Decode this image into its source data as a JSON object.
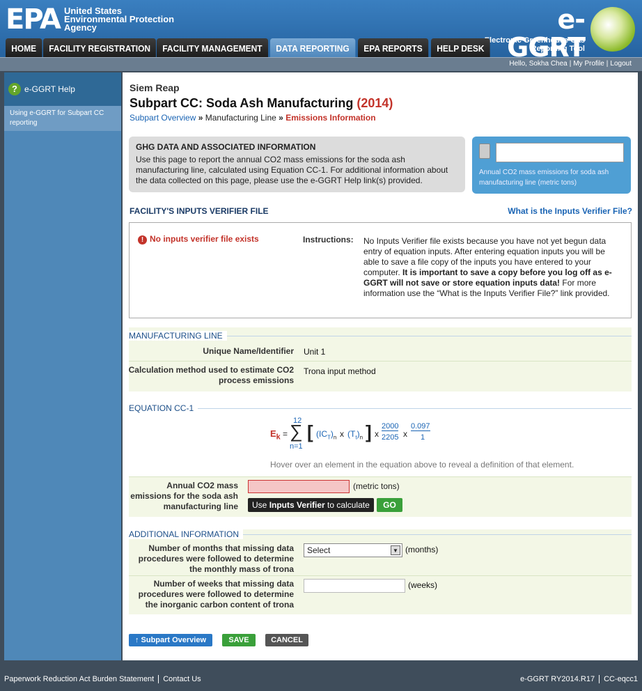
{
  "header": {
    "epa_mark": "EPA",
    "agency_line1": "United States",
    "agency_line2": "Environmental Protection",
    "agency_line3": "Agency",
    "app_name": "e-GGRT",
    "tagline1": "Electronic Greenhouse Gas",
    "tagline2": "Reporting Tool"
  },
  "nav": {
    "tabs": [
      "HOME",
      "FACILITY REGISTRATION",
      "FACILITY MANAGEMENT",
      "DATA REPORTING",
      "EPA REPORTS",
      "HELP DESK"
    ],
    "active_tab": "DATA REPORTING"
  },
  "user": {
    "greeting": "Hello, Sokha Chea",
    "profile": "My Profile",
    "logout": "Logout"
  },
  "sidebar": {
    "help_title": "e-GGRT Help",
    "help_link": "Using e-GGRT for Subpart CC reporting"
  },
  "page": {
    "facility": "Siem Reap",
    "title": "Subpart CC: Soda Ash Manufacturing",
    "year": "(2014)",
    "breadcrumb": [
      "Subpart Overview",
      "Manufacturing Line",
      "Emissions Information"
    ],
    "crumb_sep": "»"
  },
  "ghg": {
    "title": "GHG DATA AND ASSOCIATED INFORMATION",
    "text": "Use this page to report the annual CO2 mass emissions for the soda ash manufacturing line, calculated using Equation CC-1. For additional information about the data collected on this page, please use the e-GGRT Help link(s) provided.",
    "calc_label_1": "Annual CO2 mass emissions for soda ash",
    "calc_label_2": "manufacturing line (metric tons)"
  },
  "verifier": {
    "heading": "FACILITY'S INPUTS VERIFIER FILE",
    "link": "What is the Inputs Verifier File?",
    "status": "No inputs verifier file exists",
    "instructions_label": "Instructions:",
    "instructions_1": "No Inputs Verifier file exists because you have not yet begun data entry of equation inputs.  After entering equation inputs you will be able to save a file copy of the inputs you have entered to your computer.  ",
    "instructions_bold": "It is important to save a copy before you log off as e-GGRT will not save or store equation inputs data!",
    "instructions_2": " For more information use the “What is the Inputs Verifier File?” link provided."
  },
  "line": {
    "heading": "MANUFACTURING LINE",
    "name_label": "Unique Name/Identifier",
    "name_value": "Unit 1",
    "method_label_1": "Calculation method used to estimate CO2",
    "method_label_2": "process emissions",
    "method_value": "Trona input method"
  },
  "equation": {
    "heading": "EQUATION CC-1",
    "lhs": "E",
    "lhs_sub": "k",
    "equals": "=",
    "upper": "12",
    "lower": "n=1",
    "ic": "(IC",
    "ic_sub": "T",
    "ic_close": ")",
    "n1": "n",
    "x1": "x",
    "t": "(T",
    "t_sub": "t",
    "t_close": ")",
    "n2": "n",
    "x2": "x",
    "frac1_num": "2000",
    "frac1_den": "2205",
    "x3": "x",
    "frac2_num": "0.097",
    "frac2_den": "1",
    "hover_note": "Hover over an element in the equation above to reveal a definition of that element.",
    "annual_label_1": "Annual CO2 mass",
    "annual_label_2": "emissions for the soda ash",
    "annual_label_3": "manufacturing line",
    "annual_unit": "(metric tons)",
    "iv_pre": "Use ",
    "iv_bold": "Inputs Verifier",
    "iv_post": " to calculate",
    "go": "GO"
  },
  "additional": {
    "heading": "ADDITIONAL INFORMATION",
    "months_label_1": "Number of months that missing data",
    "months_label_2": "procedures were followed to determine",
    "months_label_3": "the monthly mass of trona",
    "months_selected": "Select",
    "months_unit": "(months)",
    "weeks_label_1": "Number of weeks that missing data",
    "weeks_label_2": "procedures were followed to determine",
    "weeks_label_3": "the inorganic carbon content of trona",
    "weeks_unit": "(weeks)"
  },
  "buttons": {
    "overview": "↑ Subpart Overview",
    "save": "SAVE",
    "cancel": "CANCEL"
  },
  "footer": {
    "burden": "Paperwork Reduction Act Burden Statement",
    "contact": "Contact Us",
    "version": "e-GGRT RY2014.R17",
    "page_id": "CC-eqcc1"
  }
}
